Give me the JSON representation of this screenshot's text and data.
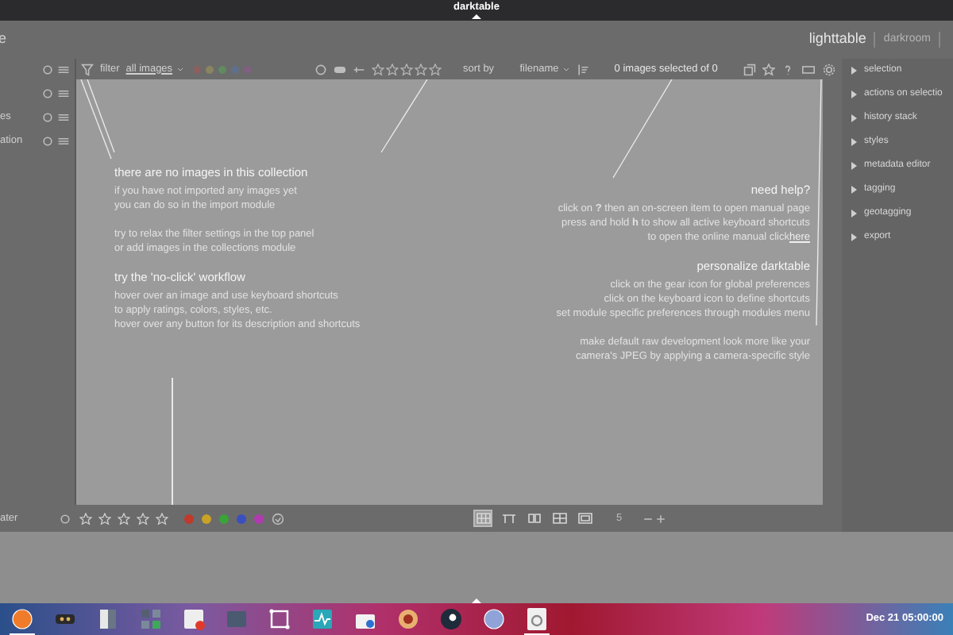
{
  "top_bar": {
    "title": "darktable"
  },
  "header": {
    "logo_fragment": "e",
    "views": [
      {
        "label": "lighttable",
        "selected": true
      },
      {
        "label": "darkroom",
        "selected": false
      }
    ]
  },
  "left_panel": {
    "items": [
      {
        "label": "es"
      },
      {
        "label": "ation"
      }
    ],
    "bottom_label": "ater"
  },
  "toolbar": {
    "filter_label": "filter",
    "filter_value": "all images",
    "sort_label": "sort by",
    "sort_value": "filename",
    "selection_count": "0 images selected of 0"
  },
  "empty_message": {
    "left": [
      {
        "kind": "heading",
        "lines": [
          "there are no images in this collection"
        ]
      },
      {
        "kind": "text",
        "lines": [
          "if you have not imported any images yet",
          "you can do so in the import module"
        ]
      },
      {
        "kind": "text",
        "lines": [
          "try to relax the filter settings in the top panel",
          "or add images in the collections module"
        ]
      },
      {
        "kind": "heading",
        "lines": [
          "try the 'no-click' workflow"
        ]
      },
      {
        "kind": "text",
        "lines": [
          "hover over an image and use keyboard shortcuts",
          "to apply ratings, colors, styles, etc.",
          "hover over any button for its description and shortcuts"
        ]
      }
    ],
    "right": [
      {
        "kind": "heading",
        "lines": [
          "need help?"
        ]
      },
      {
        "kind": "text",
        "lines": [
          "click on **?** then an on-screen item to open manual page",
          "press and hold **h** to show all active keyboard shortcuts",
          "to open the online manual click "
        ],
        "link": "here"
      },
      {
        "kind": "heading",
        "lines": [
          "personalize darktable"
        ]
      },
      {
        "kind": "text",
        "lines": [
          "click on the gear icon for global preferences",
          "click on the keyboard icon to define shortcuts",
          "set module specific preferences through modules menu"
        ]
      },
      {
        "kind": "text",
        "lines": [
          "make default raw development look more like your",
          "camera's JPEG by applying a camera-specific style"
        ]
      }
    ]
  },
  "right_panel": {
    "modules": [
      {
        "label": "selection",
        "expanded": false
      },
      {
        "label": "actions on selectio",
        "expanded": false
      },
      {
        "label": "history stack",
        "expanded": false
      },
      {
        "label": "styles",
        "expanded": false
      },
      {
        "label": "metadata editor",
        "expanded": false
      },
      {
        "label": "tagging",
        "expanded": false
      },
      {
        "label": "geotagging",
        "expanded": false
      },
      {
        "label": "export",
        "expanded": false
      }
    ]
  },
  "bottom_toolbar": {
    "stars": 0,
    "color_labels": [
      {
        "color": "#c0392b"
      },
      {
        "color": "#c9a227"
      },
      {
        "color": "#3aa33a"
      },
      {
        "color": "#3a4fc0"
      },
      {
        "color": "#b03ab0"
      }
    ],
    "layouts": [
      {
        "selected": true
      },
      {
        "selected": false
      },
      {
        "selected": false
      },
      {
        "selected": false
      },
      {
        "selected": false
      }
    ],
    "thumbs_per_row": "5"
  },
  "taskbar": {
    "apps": [
      {
        "kind": "circle",
        "running": true
      },
      {
        "kind": "mask",
        "running": false
      },
      {
        "kind": "doc",
        "running": false
      },
      {
        "kind": "tiles",
        "running": false
      },
      {
        "kind": "note",
        "running": false
      },
      {
        "kind": "screen",
        "running": false
      },
      {
        "kind": "frame",
        "running": false
      },
      {
        "kind": "pulse",
        "running": false
      },
      {
        "kind": "bag",
        "running": false
      },
      {
        "kind": "sun",
        "running": false
      },
      {
        "kind": "disc",
        "running": false
      },
      {
        "kind": "circle",
        "running": false
      },
      {
        "kind": "gear",
        "running": true
      }
    ],
    "clock": "Dec 21 05:00:00"
  }
}
